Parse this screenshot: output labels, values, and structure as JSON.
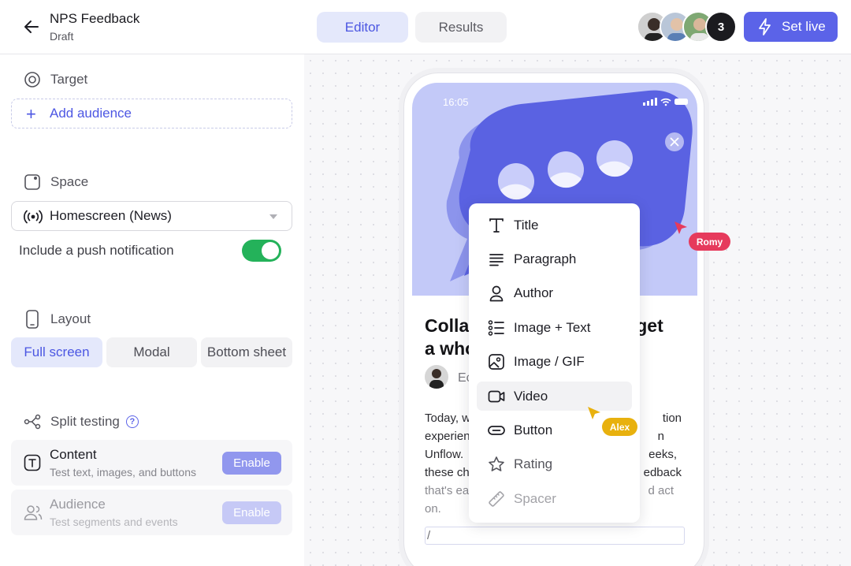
{
  "header": {
    "title": "NPS Feedback",
    "status": "Draft",
    "tabs": [
      {
        "label": "Editor"
      },
      {
        "label": "Results"
      }
    ],
    "collaborator_count": "3",
    "set_live_label": "Set live"
  },
  "sidebar": {
    "target": {
      "heading": "Target",
      "add_label": "Add audience"
    },
    "space": {
      "heading": "Space",
      "selected": "Homescreen (News)",
      "push_label": "Include a push notification",
      "push_enabled": true
    },
    "layout": {
      "heading": "Layout",
      "options": [
        {
          "label": "Full screen"
        },
        {
          "label": "Modal"
        },
        {
          "label": "Bottom sheet"
        }
      ]
    },
    "split": {
      "heading": "Split testing",
      "help": "?",
      "cards": [
        {
          "title": "Content",
          "subtitle": "Test text, images, and buttons",
          "button": "Enable"
        },
        {
          "title": "Audience",
          "subtitle": "Test segments and events",
          "button": "Enable"
        }
      ]
    }
  },
  "phone": {
    "time": "16:05",
    "title_line1": "Colla",
    "title_line1_end": "get",
    "title_line2": "a who",
    "author_partial": "Ec",
    "body": {
      "l1a": "Today, w",
      "l1b": "tion",
      "l2a": "experien",
      "l2b": "n",
      "l3a": "Unflow. ",
      "l3b": "eeks,",
      "l4a": "these ch",
      "l4b": "edback",
      "l5a": "that's ea",
      "l5b": "d act",
      "l6": "on."
    },
    "input_value": "/"
  },
  "menu": {
    "items": [
      {
        "label": "Title",
        "icon": "text-icon"
      },
      {
        "label": "Paragraph",
        "icon": "paragraph-icon"
      },
      {
        "label": "Author",
        "icon": "person-icon"
      },
      {
        "label": "Image + Text",
        "icon": "list-icon"
      },
      {
        "label": "Image / GIF",
        "icon": "image-icon"
      },
      {
        "label": "Video",
        "icon": "video-icon"
      },
      {
        "label": "Button",
        "icon": "button-icon"
      },
      {
        "label": "Rating",
        "icon": "star-icon"
      },
      {
        "label": "Spacer",
        "icon": "ruler-icon"
      }
    ]
  },
  "cursors": [
    {
      "name": "Romy",
      "color": "#e63a5c"
    },
    {
      "name": "Alex",
      "color": "#e8b10e"
    }
  ],
  "colors": {
    "accent": "#5b63e8",
    "toggle_on": "#24b25a"
  }
}
